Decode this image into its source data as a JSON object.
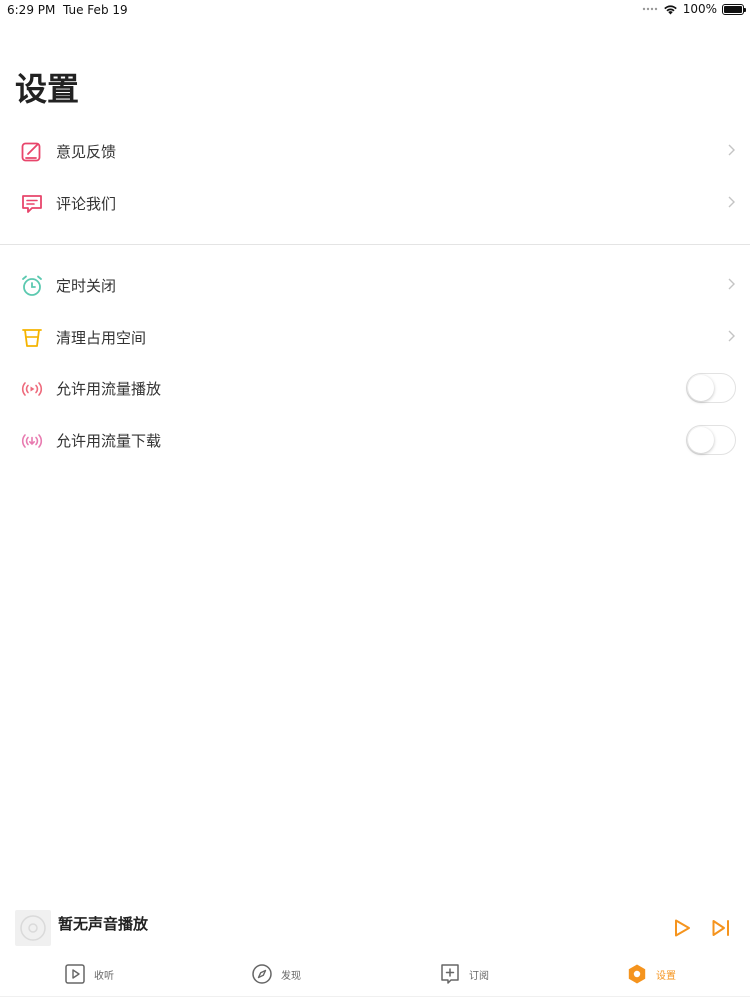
{
  "status_bar": {
    "time": "6:29 PM",
    "date": "Tue Feb 19",
    "battery": "100%"
  },
  "page": {
    "title": "设置"
  },
  "settings": {
    "group1": [
      {
        "label": "意见反馈",
        "icon": "feedback-edit-icon",
        "color": "#e8456b"
      },
      {
        "label": "评论我们",
        "icon": "comment-icon",
        "color": "#e8456b"
      }
    ],
    "group2": [
      {
        "label": "定时关闭",
        "icon": "alarm-clock-icon",
        "color": "#5cc9b0"
      },
      {
        "label": "清理占用空间",
        "icon": "trash-bin-icon",
        "color": "#f5b400"
      },
      {
        "label": "允许用流量播放",
        "icon": "cellular-play-icon",
        "color": "#ee6a7c",
        "toggle": false
      },
      {
        "label": "允许用流量下载",
        "icon": "cellular-download-icon",
        "color": "#e87bb0",
        "toggle": false
      }
    ]
  },
  "player": {
    "title": "暂无声音播放",
    "accent": "#f5941e"
  },
  "tabbar": {
    "tabs": [
      {
        "label": "收听",
        "icon": "play-square-icon",
        "active": false
      },
      {
        "label": "发现",
        "icon": "compass-icon",
        "active": false
      },
      {
        "label": "订阅",
        "icon": "add-square-icon",
        "active": false
      },
      {
        "label": "设置",
        "icon": "settings-hexagon-icon",
        "active": true
      }
    ]
  }
}
